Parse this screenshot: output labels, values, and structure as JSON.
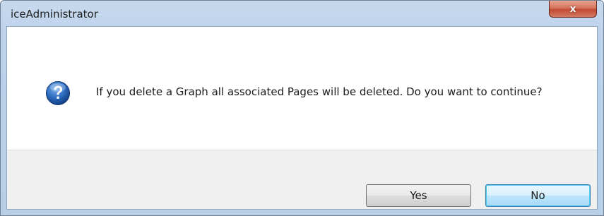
{
  "window": {
    "title": "iceAdministrator",
    "close_glyph": "x",
    "close_icon": "close-icon"
  },
  "dialog": {
    "icon": "question-icon",
    "message": "If you delete a Graph all associated Pages will be deleted. Do you want to continue?"
  },
  "buttons": {
    "yes_label": "Yes",
    "no_label": "No"
  },
  "colors": {
    "titlebar": "#bcd1ea",
    "close_button": "#c24a33",
    "icon_blue": "#1f5fb4",
    "footer": "#f0f0f0",
    "focused_button_border": "#3c7fb1"
  }
}
